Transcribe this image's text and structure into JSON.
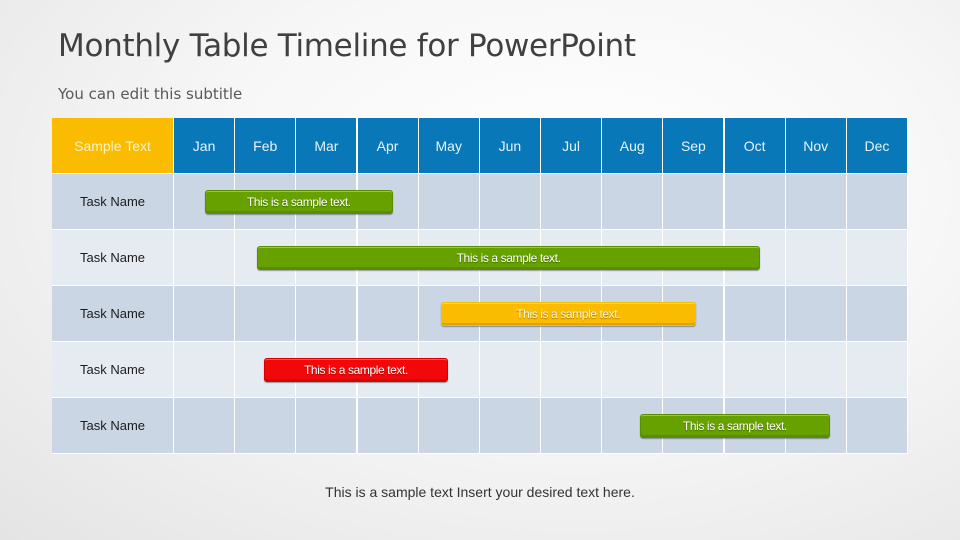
{
  "slide": {
    "title": "Monthly Table Timeline for PowerPoint",
    "subtitle": "You can edit this subtitle",
    "footer": "This is a sample text Insert your desired text here."
  },
  "colors": {
    "header_first": "#fbbb00",
    "header_month": "#0878b8",
    "row_dark": "#cad6e4",
    "row_light": "#e6ebf2",
    "green": "#66a100",
    "yellow": "#fbbb00",
    "red": "#f20808"
  },
  "table": {
    "corner_label": "Sample Text",
    "months": [
      "Jan",
      "Feb",
      "Mar",
      "Apr",
      "May",
      "Jun",
      "Jul",
      "Aug",
      "Sep",
      "Oct",
      "Nov",
      "Dec"
    ],
    "rows": [
      {
        "task": "Task Name",
        "bar": {
          "label": "This is a sample text.",
          "color": "green",
          "start_month": 0.5,
          "end_month": 3.58
        }
      },
      {
        "task": "Task Name",
        "bar": {
          "label": "This is a sample text.",
          "color": "green",
          "start_month": 1.36,
          "end_month": 9.58
        }
      },
      {
        "task": "Task Name",
        "bar": {
          "label": "This is a sample text.",
          "color": "yellow",
          "start_month": 4.36,
          "end_month": 8.53
        }
      },
      {
        "task": "Task Name",
        "bar": {
          "label": "This is a sample text.",
          "color": "red",
          "start_month": 1.47,
          "end_month": 4.48
        }
      },
      {
        "task": "Task Name",
        "bar": {
          "label": "This is a sample text.",
          "color": "green",
          "start_month": 7.62,
          "end_month": 10.72
        }
      }
    ]
  }
}
